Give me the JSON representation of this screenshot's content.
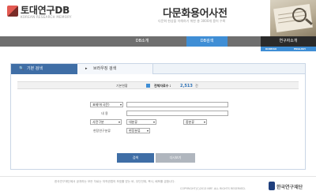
{
  "header": {
    "logo_title": "토대연구DB",
    "logo_subtitle": "KOREAN RESEARCH MEMORY",
    "site_title": "다문화용어사전",
    "site_description": "다문화 현상을 이해하기 위한 총 3000개 용어 수록"
  },
  "nav": {
    "items": [
      "DB소개",
      "DB검색",
      "연구자소개"
    ],
    "active": "DB검색",
    "lang": [
      "KOREAN",
      "ENGLISH"
    ]
  },
  "tabs": [
    {
      "label": "기본 검색",
      "icon": "search-icon",
      "active": true
    },
    {
      "label": "브라우징 검색",
      "icon": "browse-icon",
      "active": false
    }
  ],
  "summary": {
    "label": "기본현황",
    "total_label": "전체자료수 :",
    "count": "2,513",
    "unit": "건"
  },
  "form": {
    "term_select": "표제어(국문)",
    "term_value": "",
    "content_label": "내 용",
    "content_value": "",
    "dict_select": "사전구분",
    "large_cat_select": "대분류",
    "mid_cat_select": "중분류",
    "field_label": "현장연구분류",
    "field_select": "현장분류"
  },
  "buttons": {
    "search": "검색",
    "reset": "다시보기"
  },
  "footer": {
    "notice": "한국연구재단에서 공개하는 모든 자료는 저작권법의 보호를 받는 바, 무단전재, 복사, 배포를 금합니다.",
    "copyright": "COPYRIGHT(C)2013 NRF. ALL RIGHTS RESERVED.",
    "org": "한국연구재단"
  },
  "colors": {
    "accent": "#3f8ed5",
    "tab_active": "#3f6ea6",
    "nav_bg": "#6f6f6f"
  }
}
